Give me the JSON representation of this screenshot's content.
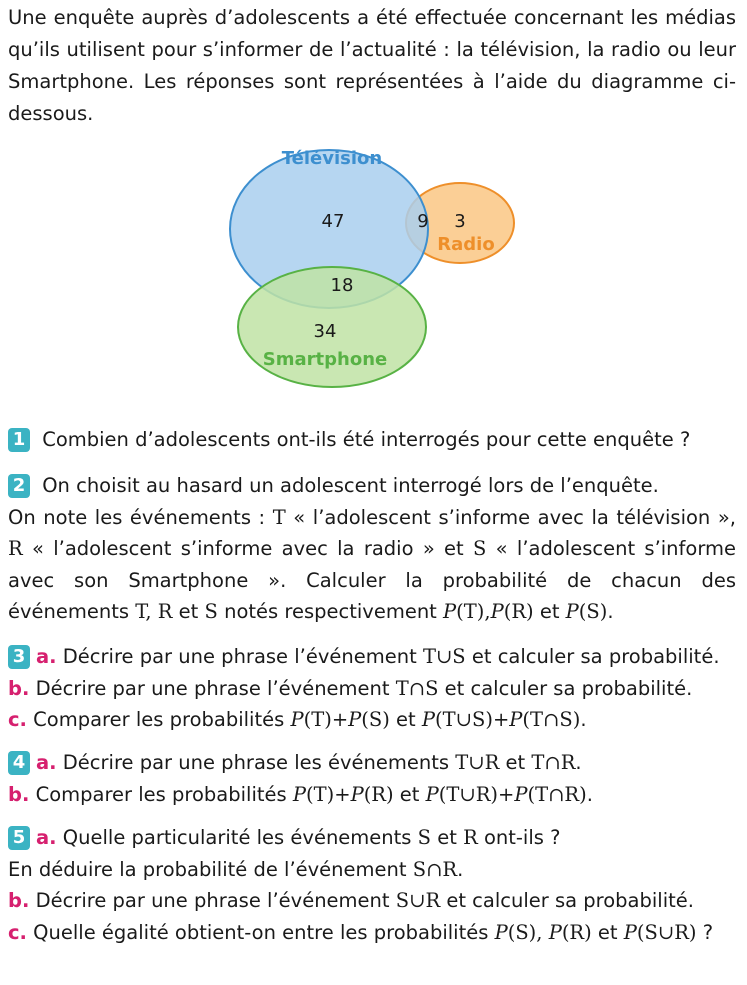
{
  "intro": "Une enquête auprès d’adolescents a été effectuée concernant les médias qu’ils utilisent pour s’informer de l’actualité : la télévision, la radio ou leur Smartphone. Les réponses sont représentées à l’aide du diagramme ci-dessous.",
  "venn": {
    "sets": {
      "television": "Télévision",
      "radio": "Radio",
      "smartphone": "Smartphone"
    },
    "regions": {
      "television_only": "47",
      "television_radio": "9",
      "radio_only": "3",
      "television_smartphone": "18",
      "smartphone_only": "34"
    },
    "colors": {
      "television": "#a9cfee",
      "television_stroke": "#3d8fcf",
      "radio": "#fbcf96",
      "radio_stroke": "#ee8f2a",
      "smartphone": "#bfe3a4",
      "smartphone_stroke": "#58b245"
    }
  },
  "q1": {
    "num": "1",
    "text": " Combien d’adolescents ont-ils été interrogés pour cette enquête ?"
  },
  "q2": {
    "num": "2",
    "l1": " On choisit au hasard un adolescent interrogé lors de l’enquête.",
    "l2a": "On note les événements : ",
    "T": "T",
    "l2b": " « l’adolescent s’informe avec la télévision », ",
    "R": "R",
    "l2c": " « l’adolescent s’informe avec la radio » et ",
    "S": "S",
    "l2d": " « l’adolescent s’informe avec son Smartphone ». Calculer la probabilité de chacun des événements ",
    "tr_list": "T, R",
    "et": " et ",
    "l2e": " notés respectivement ",
    "P": "P",
    "pT": "(T)",
    "pR": "(R)",
    "pS": "(S)",
    "comma": ",",
    "end": "."
  },
  "q3": {
    "num": "3",
    "a_label": "a.",
    "a_text": " Décrire par une phrase l’événement ",
    "a_expr": "T∪S",
    "a_end": " et calculer sa probabilité.",
    "b_label": "b.",
    "b_text": " Décrire par une phrase l’événement ",
    "b_expr": "T∩S",
    "b_end": " et calculer sa probabilité.",
    "c_label": "c.",
    "c_text": " Comparer les probabilités ",
    "c_p1": "(T)+",
    "c_p2": "(S)",
    "c_et": " et ",
    "c_p3": "(T∪S)+",
    "c_p4": "(T∩S)",
    "c_end": "."
  },
  "q4": {
    "num": "4",
    "a_label": "a.",
    "a_text": " Décrire par une phrase les événements ",
    "a_expr1": "T∪R",
    "a_et": " et ",
    "a_expr2": "T∩R",
    "a_end": ".",
    "b_label": "b.",
    "b_text": " Comparer les probabilités ",
    "b_p1": "(T)+",
    "b_p2": "(R)",
    "b_et": " et ",
    "b_p3": "(T∪R)+",
    "b_p4": "(T∩R)",
    "b_end": "."
  },
  "q5": {
    "num": "5",
    "a_label": "a.",
    "a_text1": " Quelle particularité les événements ",
    "a_S": "S",
    "a_et": " et ",
    "a_R": "R",
    "a_text2": " ont-ils ?",
    "a_line2": "En déduire la probabilité de l’événement ",
    "a_expr": "S∩R",
    "a_end": ".",
    "b_label": "b.",
    "b_text": " Décrire par une phrase l’événement ",
    "b_expr": "S∪R",
    "b_end": " et calculer sa probabilité.",
    "c_label": "c.",
    "c_text": " Quelle égalité obtient-on entre les probabilités ",
    "c_p1": "(S)",
    "c_p2": "(R)",
    "c_et": " et ",
    "c_p3": "(S∪R)",
    "c_end": " ?"
  }
}
